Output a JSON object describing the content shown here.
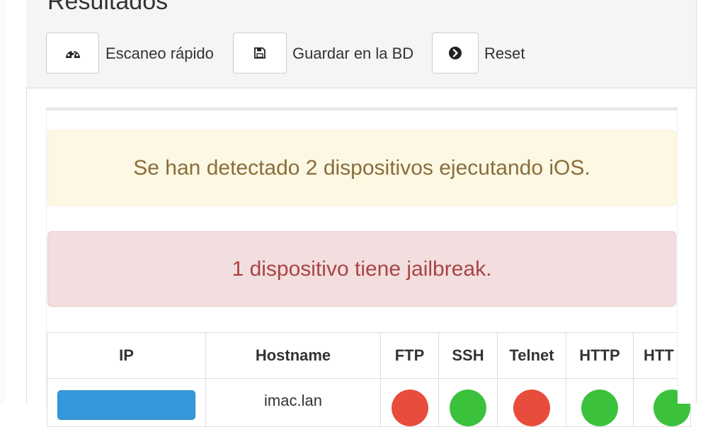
{
  "page": {
    "title": "Resultados"
  },
  "toolbar": {
    "quick_scan_label": "Escaneo rápido",
    "save_label": "Guardar en la BD",
    "reset_label": "Reset"
  },
  "alerts": {
    "warning": "Se han detectado 2 dispositivos ejecutando iOS.",
    "danger": "1 dispositivo tiene jailbreak."
  },
  "table": {
    "headers": [
      "IP",
      "Hostname",
      "FTP",
      "SSH",
      "Telnet",
      "HTTP",
      "HTT"
    ],
    "rows": [
      {
        "hostname": "imac.lan",
        "ftp": "closed",
        "ssh": "open",
        "telnet": "closed",
        "http": "open",
        "https": "open"
      }
    ]
  },
  "colors": {
    "warning_text": "#8a6d3b",
    "warning_bg": "#fcf8e3",
    "danger_text": "#a94442",
    "danger_bg": "#f2dede",
    "ip_button": "#3498db",
    "status_open": "#3cc13c",
    "status_closed": "#e74c3c"
  },
  "icons": {
    "quick_scan": "dashboard-icon",
    "save": "floppy-disk-icon",
    "reset": "circle-arrow-right-icon"
  }
}
